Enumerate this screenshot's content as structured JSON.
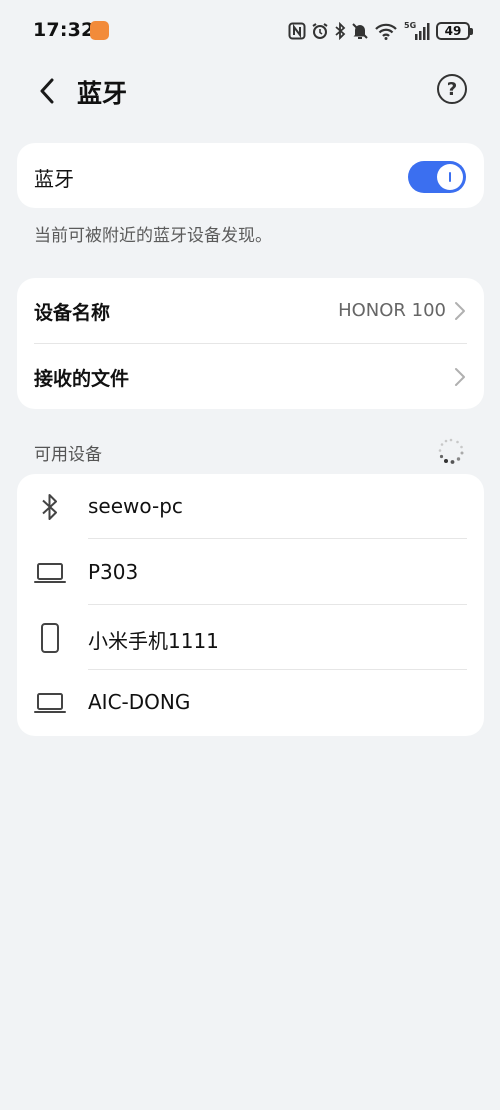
{
  "status_bar": {
    "time": "17:32",
    "battery": "49",
    "network": "5G"
  },
  "header": {
    "title": "蓝牙"
  },
  "bluetooth_card": {
    "label": "蓝牙",
    "toggle_on": true
  },
  "hint": "当前可被附近的蓝牙设备发现。",
  "info_card": {
    "device_name_label": "设备名称",
    "device_name_value": "HONOR 100",
    "received_files_label": "接收的文件"
  },
  "available_devices": {
    "section_title": "可用设备",
    "devices": [
      {
        "name": "seewo-pc",
        "icon": "bluetooth-icon"
      },
      {
        "name": "P303",
        "icon": "laptop-icon"
      },
      {
        "name": "小米手机1111",
        "icon": "phone-icon"
      },
      {
        "name": "AIC-DONG",
        "icon": "laptop-icon"
      }
    ]
  },
  "colors": {
    "accent": "#3b6ff0",
    "background": "#f1f3f5"
  }
}
